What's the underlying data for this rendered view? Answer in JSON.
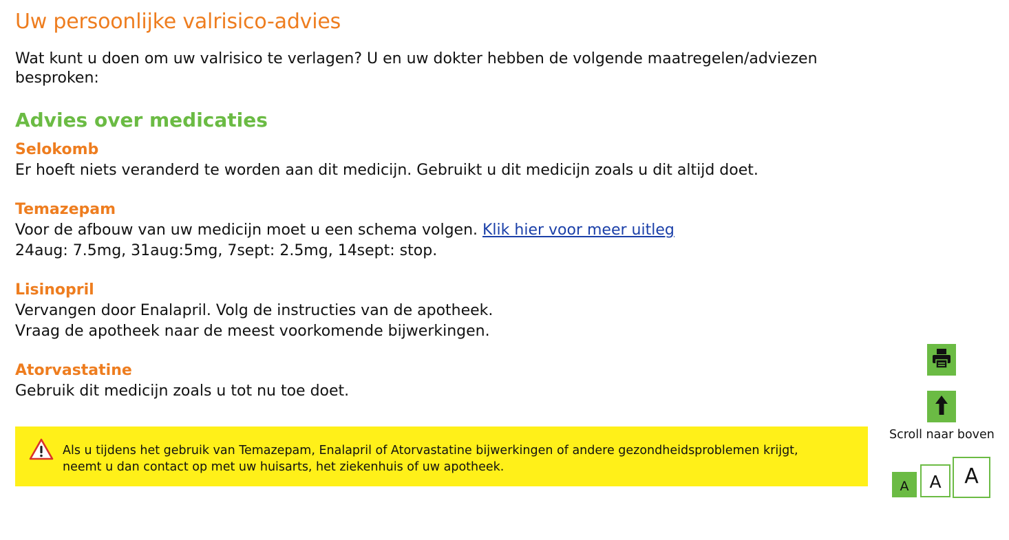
{
  "page": {
    "title": "Uw persoonlijke valrisico-advies",
    "intro": "Wat kunt u doen om uw valrisico te verlagen? U en uw dokter hebben de volgende maatregelen/adviezen besproken:"
  },
  "section": {
    "heading": "Advies over medicaties"
  },
  "medications": [
    {
      "name": "Selokomb",
      "line1": "Er hoeft niets veranderd te worden aan dit medicijn. Gebruikt u dit medicijn zoals u dit altijd doet."
    },
    {
      "name": "Temazepam",
      "line1": "Voor de afbouw van uw medicijn moet u een schema volgen.",
      "link": "Klik hier voor meer uitleg",
      "line2": "24aug: 7.5mg, 31aug:5mg, 7sept: 2.5mg, 14sept: stop."
    },
    {
      "name": "Lisinopril",
      "line1": "Vervangen door Enalapril. Volg de instructies van de apotheek.",
      "line2": "Vraag de apotheek naar de meest voorkomende bijwerkingen."
    },
    {
      "name": "Atorvastatine",
      "line1": "Gebruik dit medicijn zoals u tot nu toe doet."
    }
  ],
  "warning": {
    "line1": "Als u tijdens het gebruik van Temazepam, Enalapril of Atorvastatine bijwerkingen of andere gezondheidsproblemen krijgt,",
    "line2": "neemt u dan contact op met uw huisarts, het ziekenhuis of uw apotheek."
  },
  "sidebar": {
    "print_icon": "printer-icon",
    "scroll_icon": "arrow-up-icon",
    "scroll_label": "Scroll naar boven",
    "font_sizes": [
      "A",
      "A",
      "A"
    ]
  },
  "colors": {
    "orange": "#ee7d1f",
    "green": "#6bbb44",
    "warning_bg": "#fff019",
    "link": "#1a3fa8"
  }
}
